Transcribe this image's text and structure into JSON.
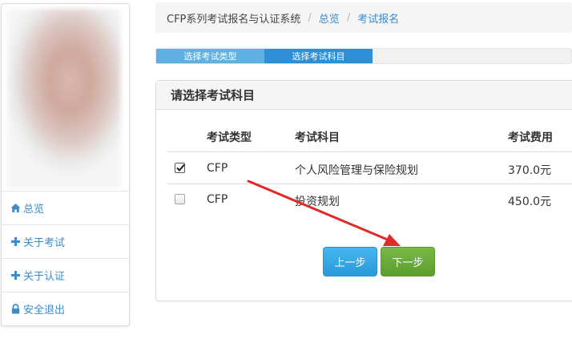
{
  "sidebar": {
    "items": [
      {
        "label": "总览",
        "icon": "home-icon"
      },
      {
        "label": "关于考试",
        "icon": "plus-icon"
      },
      {
        "label": "关于认证",
        "icon": "plus-icon"
      },
      {
        "label": "安全退出",
        "icon": "lock-icon"
      }
    ]
  },
  "breadcrumb": {
    "system": "CFP系列考试报名与认证系统",
    "overview": "总览",
    "current": "考试报名",
    "separator": "/"
  },
  "steps": {
    "step1": "选择考试类型",
    "step2": "选择考试科目"
  },
  "panel": {
    "title": "请选择考试科目",
    "headers": {
      "type": "考试类型",
      "subject": "考试科目",
      "fee": "考试费用"
    },
    "rows": [
      {
        "checked": true,
        "type": "CFP",
        "subject": "个人风险管理与保险规划",
        "fee": "370.0元"
      },
      {
        "checked": false,
        "type": "CFP",
        "subject": "投资规划",
        "fee": "450.0元"
      }
    ]
  },
  "buttons": {
    "prev": "上一步",
    "next": "下一步"
  },
  "colors": {
    "link": "#3a8ccf",
    "prev_button": "#2a9ad8",
    "next_button": "#5c9e2e",
    "step_active": "#2f8fd6",
    "arrow": "#e02a2a"
  }
}
